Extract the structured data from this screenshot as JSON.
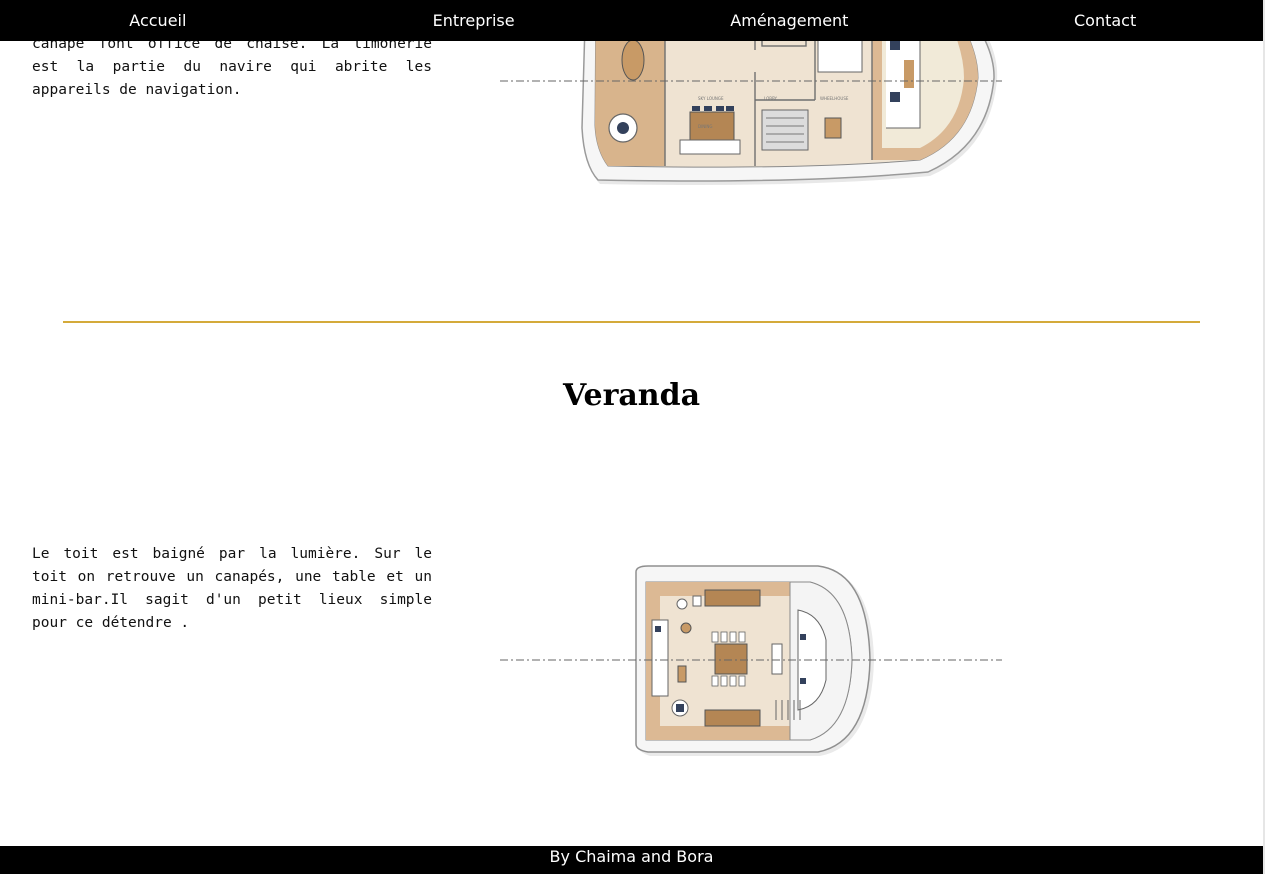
{
  "nav": {
    "items": [
      {
        "label": "Accueil"
      },
      {
        "label": "Entreprise"
      },
      {
        "label": "Aménagement"
      },
      {
        "label": "Contact"
      }
    ]
  },
  "sections": {
    "upper": {
      "text": "canapé font office de chaise. La timonerie est la partie du navire qui abrite les appareils de navigation."
    },
    "veranda": {
      "title": "Veranda",
      "text": "Le toit est baigné par la lumière. Sur le toit on retrouve un canapés, une table et un mini-bar.Il sagit d'un petit lieux simple pour ce détendre ."
    }
  },
  "footer": {
    "text": "By Chaima and Bora"
  },
  "colors": {
    "nav_bg": "#000000",
    "divider": "#d4aa3a",
    "floor": "#d8b48c",
    "floor_light": "#efe3d2",
    "hull": "#f3f3f3"
  }
}
